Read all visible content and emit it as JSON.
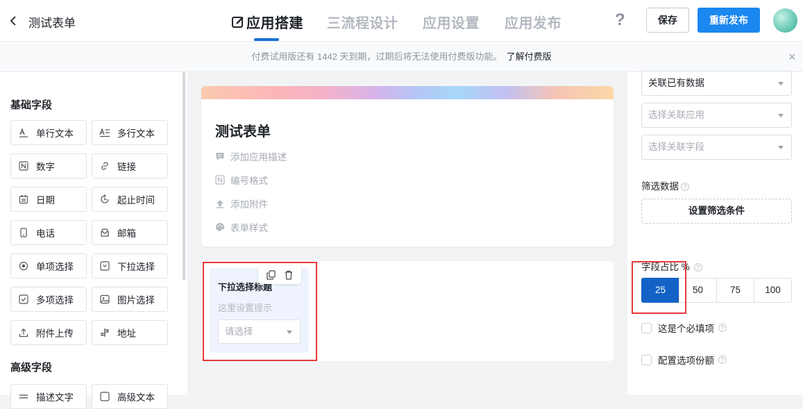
{
  "header": {
    "app_title": "测试表单",
    "tabs": [
      {
        "label": "应用搭建"
      },
      {
        "label": "三流程设计"
      },
      {
        "label": "应用设置"
      },
      {
        "label": "应用发布"
      }
    ],
    "help": "?",
    "save_label": "保存",
    "publish_label": "重新发布"
  },
  "notice": {
    "text": "付费试用版还有 1442 天到期，过期后将无法使用付费版功能。",
    "link": "了解付费版",
    "close": "×"
  },
  "left_panel": {
    "basic_title": "基础字段",
    "basic_fields": [
      {
        "label": "单行文本",
        "icon": "single-line-text-icon"
      },
      {
        "label": "多行文本",
        "icon": "multi-line-text-icon"
      },
      {
        "label": "数字",
        "icon": "number-icon"
      },
      {
        "label": "链接",
        "icon": "link-icon"
      },
      {
        "label": "日期",
        "icon": "calendar-icon"
      },
      {
        "label": "起止时间",
        "icon": "time-range-icon"
      },
      {
        "label": "电话",
        "icon": "phone-icon"
      },
      {
        "label": "邮箱",
        "icon": "mail-icon"
      },
      {
        "label": "单项选择",
        "icon": "radio-icon"
      },
      {
        "label": "下拉选择",
        "icon": "dropdown-icon"
      },
      {
        "label": "多项选择",
        "icon": "checkbox-icon"
      },
      {
        "label": "图片选择",
        "icon": "image-icon"
      },
      {
        "label": "附件上传",
        "icon": "upload-icon"
      },
      {
        "label": "地址",
        "icon": "location-icon"
      }
    ],
    "advanced_title": "高级字段",
    "advanced_fields": [
      {
        "label": "描述文字"
      },
      {
        "label": "高级文本"
      }
    ]
  },
  "form": {
    "title": "测试表单",
    "meta": [
      {
        "label": "添加应用描述",
        "icon": "comment-icon"
      },
      {
        "label": "编号格式",
        "icon": "number-format-icon"
      },
      {
        "label": "添加附件",
        "icon": "upload-icon"
      },
      {
        "label": "表单样式",
        "icon": "palette-icon"
      }
    ],
    "dropdown_field": {
      "title": "下拉选择标题",
      "hint": "这里设置提示",
      "placeholder": "请选择"
    }
  },
  "right_panel": {
    "data_source": "关联已有数据",
    "related_app_placeholder": "选择关联应用",
    "related_field_placeholder": "选择关联字段",
    "filter_label": "筛选数据",
    "filter_button": "设置筛选条件",
    "ratio_label": "字段占比 %",
    "ratios": [
      "25",
      "50",
      "75",
      "100"
    ],
    "ratio_selected": "25",
    "checkboxes": [
      {
        "label": "这是个必填项",
        "checked": false
      },
      {
        "label": "配置选项份额",
        "checked": false
      }
    ]
  },
  "colors": {
    "accent": "#1b87f0",
    "selected_ratio": "#1462c6",
    "highlight": "#e5393a"
  }
}
